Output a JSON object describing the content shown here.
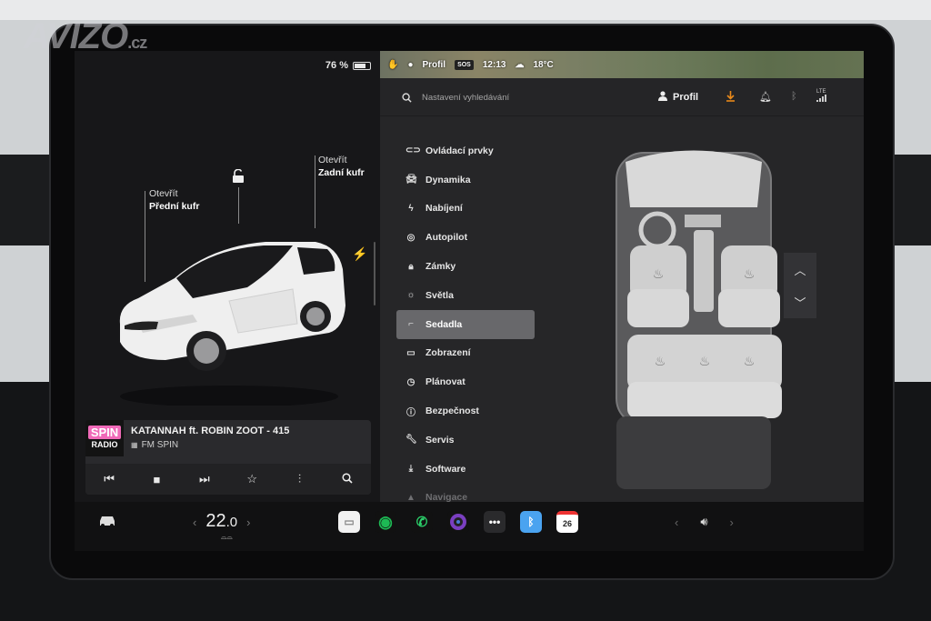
{
  "watermark": {
    "brand": "AVIZO",
    "tld": ".cz"
  },
  "status": {
    "battery_percent": "76 %",
    "battery_level": 0.76
  },
  "car": {
    "frunk": {
      "action": "Otevřít",
      "target": "Přední kufr"
    },
    "trunk": {
      "action": "Otevřít",
      "target": "Zadní kufr"
    },
    "body_color": "#f1f1f1"
  },
  "media": {
    "art_line1": "SPIN",
    "art_line2": "RADIO",
    "title": "KATANNAH ft. ROBIN ZOOT - 415",
    "station": "FM SPIN"
  },
  "top_status": {
    "profile": "Profil",
    "sos": "SOS",
    "time": "12:13",
    "temperature": "18°C"
  },
  "search": {
    "placeholder": "Nastavení vyhledávání"
  },
  "header": {
    "profile_label": "Profil",
    "network": "LTE"
  },
  "menu": [
    {
      "label": "Ovládací prvky",
      "icon": "toggle-icon"
    },
    {
      "label": "Dynamika",
      "icon": "car-icon"
    },
    {
      "label": "Nabíjení",
      "icon": "bolt-icon"
    },
    {
      "label": "Autopilot",
      "icon": "steering-wheel-icon"
    },
    {
      "label": "Zámky",
      "icon": "lock-icon"
    },
    {
      "label": "Světla",
      "icon": "sun-icon"
    },
    {
      "label": "Sedadla",
      "icon": "seat-icon",
      "active": true
    },
    {
      "label": "Zobrazení",
      "icon": "display-icon"
    },
    {
      "label": "Plánovat",
      "icon": "clock-icon"
    },
    {
      "label": "Bezpečnost",
      "icon": "info-icon"
    },
    {
      "label": "Servis",
      "icon": "wrench-icon"
    },
    {
      "label": "Software",
      "icon": "download-icon"
    },
    {
      "label": "Navigace",
      "icon": "navigation-icon"
    }
  ],
  "dock": {
    "temp_whole": "22",
    "temp_decimal": ".0",
    "calendar_day": "26"
  },
  "colors": {
    "accent_orange": "#e8891a",
    "active_menu": "#68686b",
    "spotify": "#1db954",
    "phone": "#2bd06a"
  }
}
